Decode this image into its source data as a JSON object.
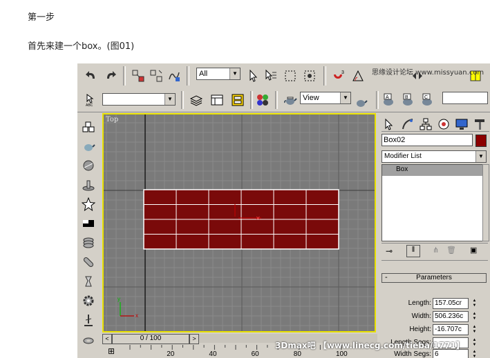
{
  "article": {
    "step_title": "第一步",
    "instruction": "首先来建一个box。(图01)"
  },
  "toolbar1": {
    "selection_filter": "All"
  },
  "toolbar2": {
    "named_selection": "",
    "reference_coord": "View"
  },
  "viewport": {
    "label": "Top",
    "box_fill": "#7a0a0a",
    "grid_rows": 4,
    "grid_cols": 6
  },
  "command_panel": {
    "object_name": "Box02",
    "object_color": "#8b0000",
    "modifier_list": "Modifier List",
    "stack_item": "Box",
    "rollout_title": "Parameters",
    "params": [
      {
        "label": "Length:",
        "value": "157.05cr"
      },
      {
        "label": "Width:",
        "value": "506.236c"
      },
      {
        "label": "Height:",
        "value": "-16.707c"
      },
      {
        "label": "Length Segs:",
        "value": ""
      },
      {
        "label": "Width Segs:",
        "value": "6"
      }
    ]
  },
  "timeline": {
    "frame": "0 / 100",
    "ticks": [
      "20",
      "40",
      "60",
      "80",
      "100"
    ]
  },
  "watermarks": {
    "top": "思缘设计论坛 www.missyuan.com",
    "bottom": "3Dmax吧 【www.linecg.com/tieba/1771】"
  }
}
